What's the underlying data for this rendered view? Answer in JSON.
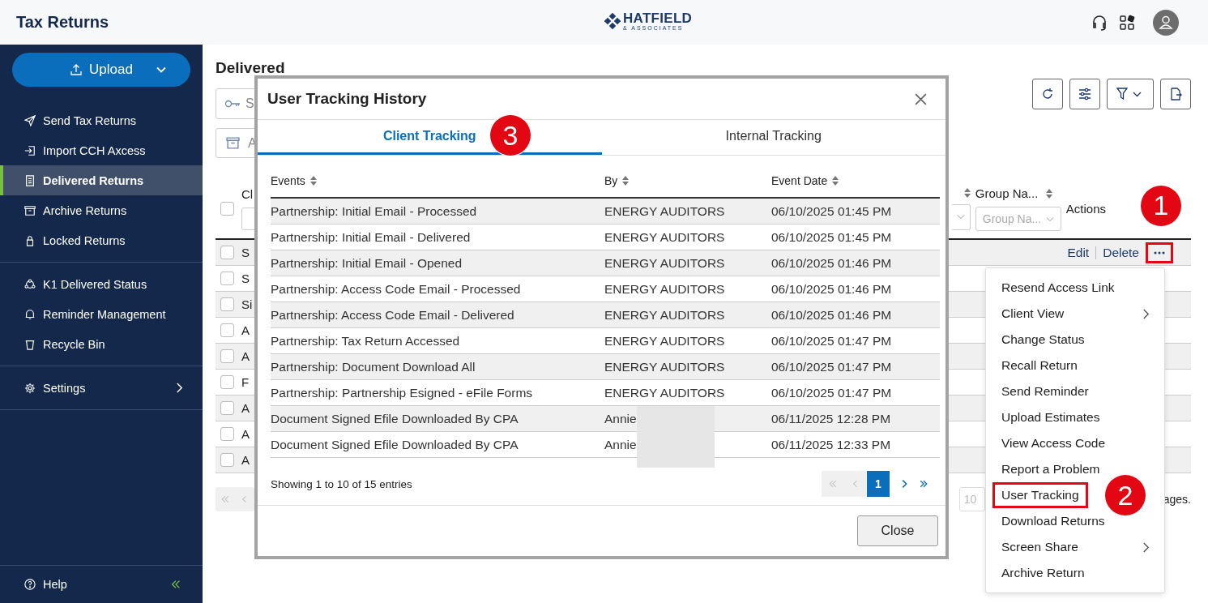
{
  "header": {
    "title": "Tax Returns",
    "logo": {
      "name": "HATFIELD",
      "tagline": "& ASSOCIATES"
    }
  },
  "sidebar": {
    "upload": {
      "label": "Upload"
    },
    "groups": [
      {
        "items": [
          {
            "label": "Send Tax Returns",
            "kind": "send",
            "selected": false,
            "submenu": false
          },
          {
            "label": "Import CCH Axcess",
            "kind": "import",
            "selected": false,
            "submenu": false
          },
          {
            "label": "Delivered Returns",
            "kind": "document",
            "selected": true,
            "submenu": false
          },
          {
            "label": "Archive Returns",
            "kind": "archive",
            "selected": false,
            "submenu": false
          },
          {
            "label": "Locked Returns",
            "kind": "lock",
            "selected": false,
            "submenu": false
          }
        ]
      },
      {
        "items": [
          {
            "label": "K1 Delivered Status",
            "kind": "network",
            "selected": false,
            "submenu": false
          },
          {
            "label": "Reminder Management",
            "kind": "bell",
            "selected": false,
            "submenu": false
          },
          {
            "label": "Recycle Bin",
            "kind": "bin",
            "selected": false,
            "submenu": false
          }
        ]
      },
      {
        "items": [
          {
            "label": "Settings",
            "kind": "gear",
            "selected": false,
            "submenu": true
          }
        ]
      }
    ],
    "help": {
      "label": "Help"
    }
  },
  "page": {
    "heading": "Delivered",
    "search": {
      "placeholder": "S"
    },
    "archive_button": {
      "label": "A"
    },
    "table": {
      "first_column": {
        "label": "Cl",
        "checked": false
      },
      "right_columns": [
        {
          "kind": "cut"
        },
        {
          "kind": "filter",
          "label": "Group Na...",
          "filter_placeholder": "Group Na..."
        },
        {
          "kind": "plain",
          "label": "Actions"
        }
      ],
      "rows": [
        {
          "cell": "S",
          "checked": false,
          "actions": {
            "edit": "Edit",
            "delete": "Delete",
            "more_highlighted": true,
            "callout": "1"
          }
        },
        {
          "cell": "S",
          "checked": false
        },
        {
          "cell": "Si",
          "checked": false
        },
        {
          "cell": "A",
          "checked": false
        },
        {
          "cell": "A",
          "checked": false
        },
        {
          "cell": "F",
          "checked": false
        },
        {
          "cell": "A",
          "checked": false
        },
        {
          "cell": "A",
          "checked": false
        },
        {
          "cell": "A",
          "checked": false
        }
      ]
    },
    "pagination": {
      "page_size": "10",
      "note": "ages."
    }
  },
  "menu": {
    "items": [
      {
        "label": "Resend Access Link",
        "submenu": false,
        "highlighted": false
      },
      {
        "label": "Client View",
        "submenu": true,
        "highlighted": false
      },
      {
        "label": "Change Status",
        "submenu": false,
        "highlighted": false
      },
      {
        "label": "Recall Return",
        "submenu": false,
        "highlighted": false
      },
      {
        "label": "Send Reminder",
        "submenu": false,
        "highlighted": false
      },
      {
        "label": "Upload Estimates",
        "submenu": false,
        "highlighted": false
      },
      {
        "label": "View Access Code",
        "submenu": false,
        "highlighted": false
      },
      {
        "label": "Report a Problem",
        "submenu": false,
        "highlighted": false
      },
      {
        "label": "User Tracking",
        "submenu": false,
        "highlighted": true,
        "callout": "2"
      },
      {
        "label": "Download Returns",
        "submenu": false,
        "highlighted": false
      },
      {
        "label": "Screen Share",
        "submenu": true,
        "highlighted": false
      },
      {
        "label": "Archive Return",
        "submenu": false,
        "highlighted": false
      }
    ]
  },
  "modal": {
    "title": "User Tracking History",
    "tabs": [
      {
        "label": "Client Tracking",
        "selected": true,
        "callout": "3"
      },
      {
        "label": "Internal Tracking",
        "selected": false
      }
    ],
    "columns": [
      "Events",
      "By",
      "Event Date"
    ],
    "rows": [
      {
        "event": "Partnership: Initial Email - Processed",
        "by": "ENERGY AUDITORS",
        "date": "06/10/2025 01:45 PM",
        "redacted": false
      },
      {
        "event": "Partnership: Initial Email - Delivered",
        "by": "ENERGY AUDITORS",
        "date": "06/10/2025 01:45 PM",
        "redacted": false
      },
      {
        "event": "Partnership: Initial Email - Opened",
        "by": "ENERGY AUDITORS",
        "date": "06/10/2025 01:46 PM",
        "redacted": false
      },
      {
        "event": "Partnership: Access Code Email - Processed",
        "by": "ENERGY AUDITORS",
        "date": "06/10/2025 01:46 PM",
        "redacted": false
      },
      {
        "event": "Partnership: Access Code Email - Delivered",
        "by": "ENERGY AUDITORS",
        "date": "06/10/2025 01:46 PM",
        "redacted": false
      },
      {
        "event": "Partnership: Tax Return Accessed",
        "by": "ENERGY AUDITORS",
        "date": "06/10/2025 01:47 PM",
        "redacted": false
      },
      {
        "event": "Partnership: Document Download All",
        "by": "ENERGY AUDITORS",
        "date": "06/10/2025 01:47 PM",
        "redacted": false
      },
      {
        "event": "Partnership: Partnership Esigned - eFile Forms",
        "by": "ENERGY AUDITORS",
        "date": "06/10/2025 01:47 PM",
        "redacted": false
      },
      {
        "event": "Document Signed Efile Downloaded By CPA",
        "by": "Annie",
        "date": "06/11/2025 12:28 PM",
        "redacted": true
      },
      {
        "event": "Document Signed Efile Downloaded By CPA",
        "by": "Annie",
        "date": "06/11/2025 12:33 PM",
        "redacted": true
      }
    ],
    "summary": "Showing 1 to 10 of 15 entries",
    "pages": [
      {
        "label": "1",
        "selected": true
      }
    ],
    "close_label": "Close"
  }
}
